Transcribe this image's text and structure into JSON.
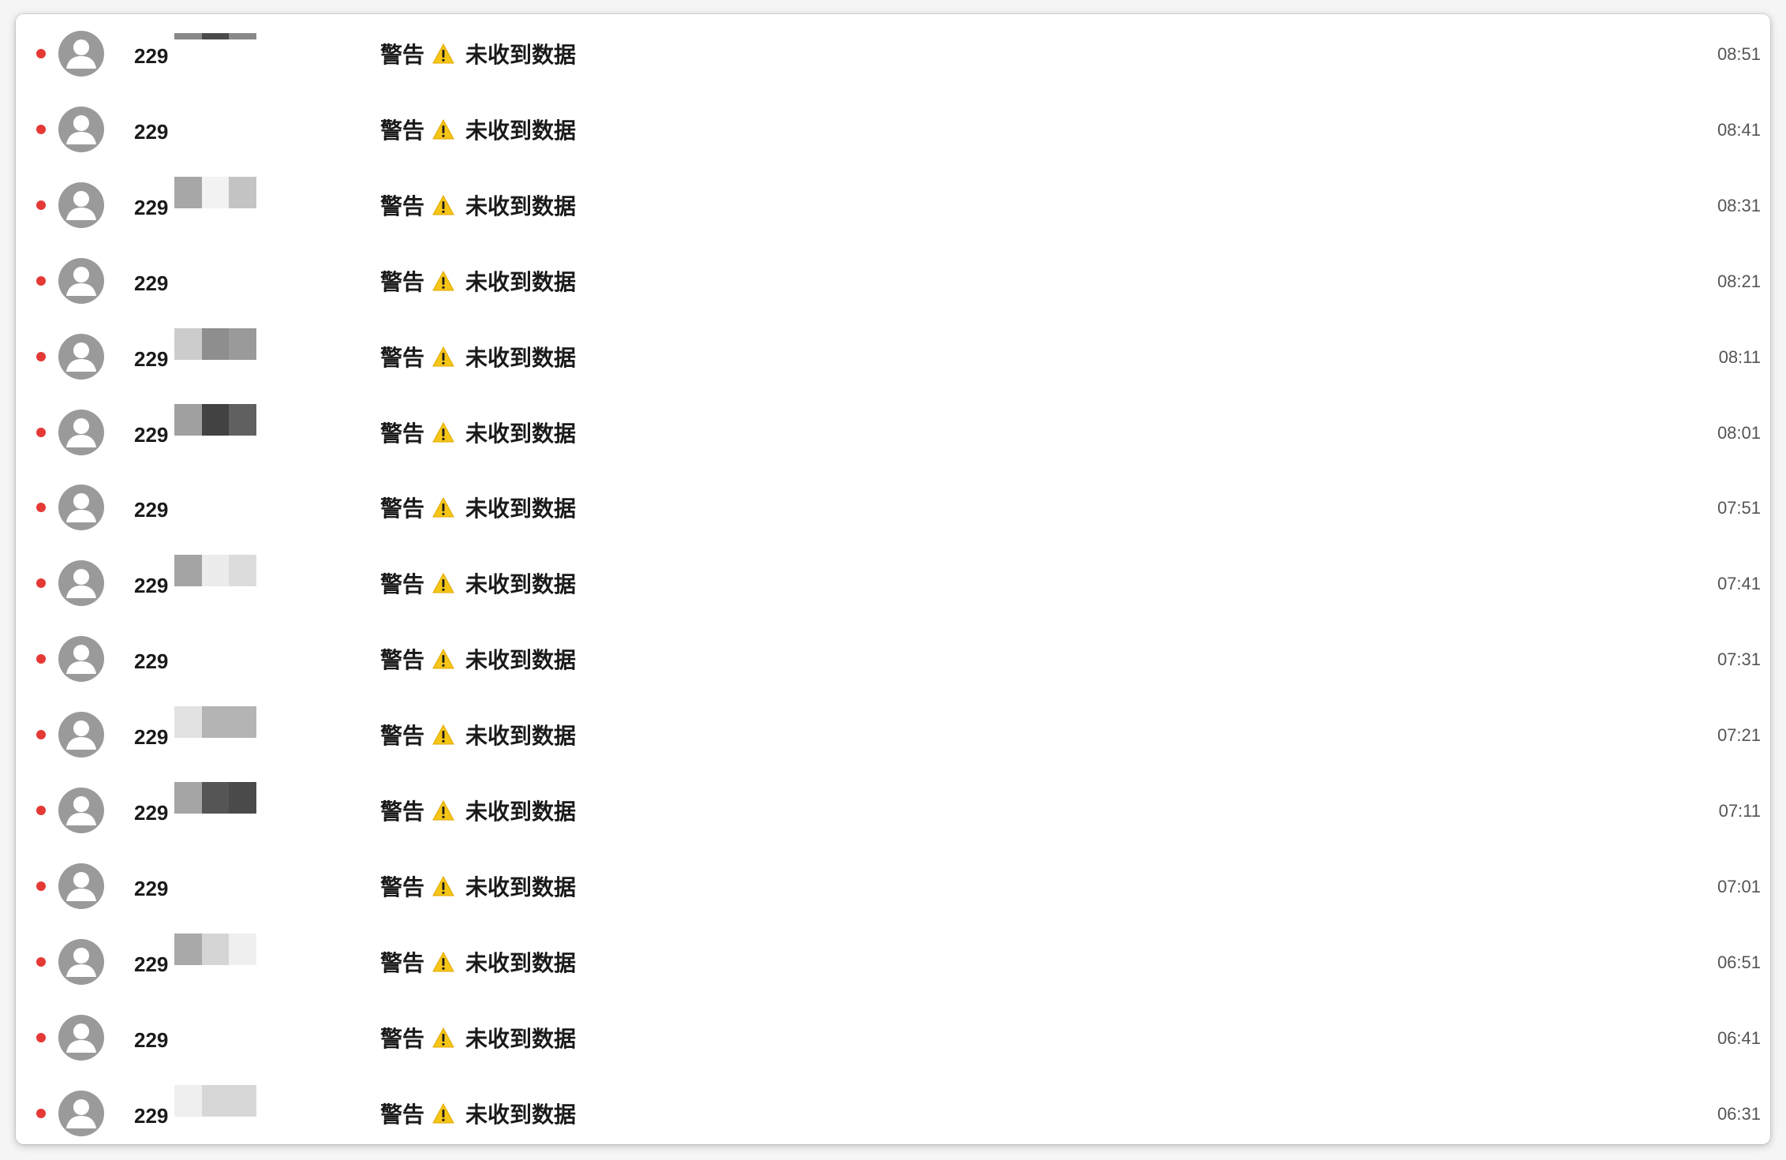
{
  "colors": {
    "unread_dot": "#e53935",
    "avatar_bg": "#9a9a9a",
    "warning_yellow": "#f5c518"
  },
  "icons": {
    "avatar": "person-silhouette-icon",
    "warning": "warning-triangle-icon",
    "unread": "unread-dot-icon"
  },
  "rows": [
    {
      "sender": "229",
      "label": "警告",
      "message": "未收到数据",
      "time": "08:51",
      "mosaic": [
        "#888888",
        "#4a4a4a",
        "#888888"
      ],
      "mosaic_partial": true
    },
    {
      "sender": "229",
      "label": "警告",
      "message": "未收到数据",
      "time": "08:41",
      "mosaic": [],
      "mosaic_partial": false
    },
    {
      "sender": "229",
      "label": "警告",
      "message": "未收到数据",
      "time": "08:31",
      "mosaic": [
        "#a7a7a7",
        "#f2f2f2",
        "#c4c4c4"
      ],
      "mosaic_partial": false
    },
    {
      "sender": "229",
      "label": "警告",
      "message": "未收到数据",
      "time": "08:21",
      "mosaic": [],
      "mosaic_partial": false
    },
    {
      "sender": "229",
      "label": "警告",
      "message": "未收到数据",
      "time": "08:11",
      "mosaic": [
        "#cccccc",
        "#8e8e8e",
        "#9a9a9a"
      ],
      "mosaic_partial": false
    },
    {
      "sender": "229",
      "label": "警告",
      "message": "未收到数据",
      "time": "08:01",
      "mosaic": [
        "#a0a0a0",
        "#424242",
        "#606060"
      ],
      "mosaic_partial": false
    },
    {
      "sender": "229",
      "label": "警告",
      "message": "未收到数据",
      "time": "07:51",
      "mosaic": [],
      "mosaic_partial": false
    },
    {
      "sender": "229",
      "label": "警告",
      "message": "未收到数据",
      "time": "07:41",
      "mosaic": [
        "#a4a4a4",
        "#ececec",
        "#dcdcdc"
      ],
      "mosaic_partial": false
    },
    {
      "sender": "229",
      "label": "警告",
      "message": "未收到数据",
      "time": "07:31",
      "mosaic": [],
      "mosaic_partial": false
    },
    {
      "sender": "229",
      "label": "警告",
      "message": "未收到数据",
      "time": "07:21",
      "mosaic": [
        "#e2e2e2",
        "#b4b4b4",
        "#b4b4b4"
      ],
      "mosaic_partial": false
    },
    {
      "sender": "229",
      "label": "警告",
      "message": "未收到数据",
      "time": "07:11",
      "mosaic": [
        "#a5a5a5",
        "#555555",
        "#4a4a4a"
      ],
      "mosaic_partial": false
    },
    {
      "sender": "229",
      "label": "警告",
      "message": "未收到数据",
      "time": "07:01",
      "mosaic": [],
      "mosaic_partial": false
    },
    {
      "sender": "229",
      "label": "警告",
      "message": "未收到数据",
      "time": "06:51",
      "mosaic": [
        "#a9a9a9",
        "#d5d5d5",
        "#efefef"
      ],
      "mosaic_partial": false
    },
    {
      "sender": "229",
      "label": "警告",
      "message": "未收到数据",
      "time": "06:41",
      "mosaic": [],
      "mosaic_partial": false
    },
    {
      "sender": "229",
      "label": "警告",
      "message": "未收到数据",
      "time": "06:31",
      "mosaic": [
        "#efefef",
        "#d7d7d7",
        "#d7d7d7"
      ],
      "mosaic_partial": false
    }
  ]
}
